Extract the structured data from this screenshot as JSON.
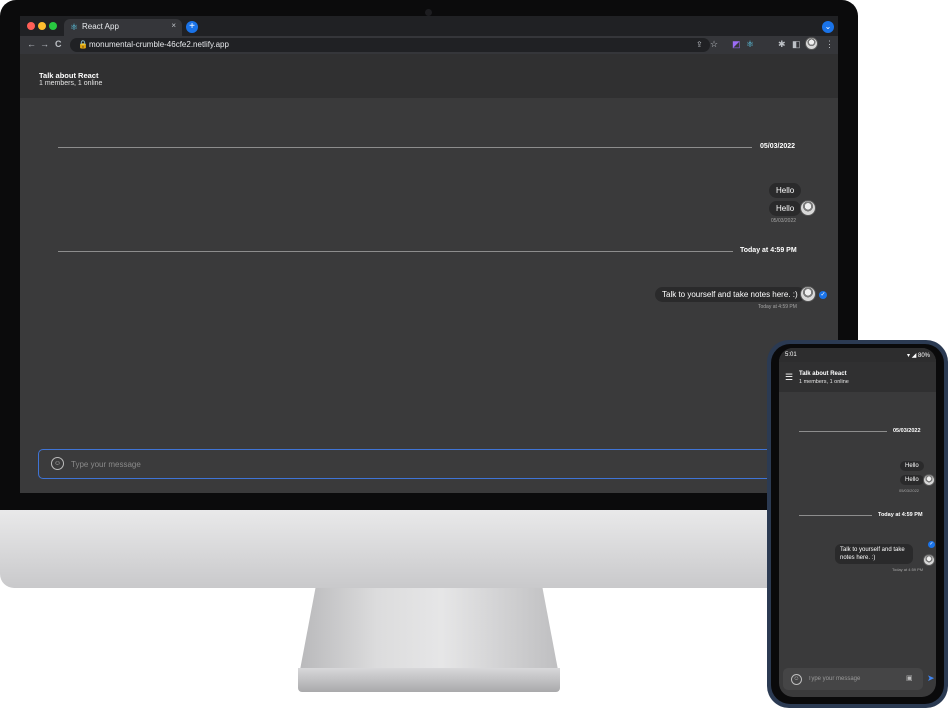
{
  "browser": {
    "tab_title": "React App",
    "tab_close": "×",
    "new_tab": "+",
    "url": "monumental-crumble-46cfe2.netlify.app",
    "icons": {
      "back": "←",
      "forward": "→",
      "reload": "C",
      "lock": "🔒",
      "share": "⇪",
      "star": "☆",
      "extensions": "✱",
      "sidebar": "◧",
      "menu": "⋮",
      "profile_chevron": "⌄"
    }
  },
  "chat": {
    "title": "Talk about React",
    "subtitle": "1 members, 1 online",
    "groups": [
      {
        "date": "05/03/2022",
        "messages": [
          "Hello",
          "Hello"
        ],
        "time": "05/03/2022"
      },
      {
        "date": "Today at 4:59 PM",
        "messages": [
          "Talk to yourself and take notes here. :)"
        ],
        "time": "Today at 4:59 PM"
      }
    ],
    "composer": {
      "placeholder": "Type your message",
      "emoji_icon": "☺"
    }
  },
  "phone": {
    "status_time": "5:01",
    "status_icons": "▾ ◢ 80%",
    "menu_icon": "☰",
    "title": "Talk about React",
    "subtitle": "1 members, 1 online",
    "date1": "05/03/2022",
    "msg1": "Hello",
    "msg2": "Hello",
    "time1": "05/03/2022",
    "date2": "Today at 4:59 PM",
    "msg3": "Talk to yourself and take notes here. :)",
    "time2": "Today at 4:59 PM",
    "placeholder": "Type your message",
    "attach_icon": "▣",
    "send_icon": "➤",
    "emoji_icon": "☺"
  },
  "colors": {
    "app_bg": "#3a3a3b",
    "header_bg": "#303031",
    "bubble_bg": "#2a2a2b",
    "accent": "#1a73e8",
    "composer_border": "#3f74d6"
  }
}
